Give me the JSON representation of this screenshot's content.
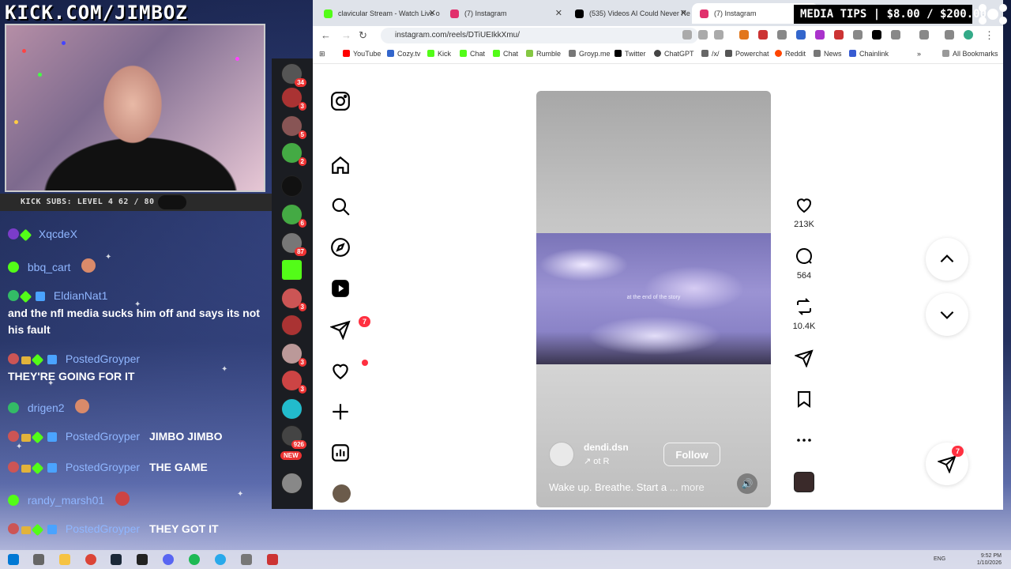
{
  "overlay": {
    "kick_header": "KICK.COM/JIMBOZ",
    "kick_subs": "KICK SUBS: LEVEL 4 62 / 80",
    "media_tips": "MEDIA TIPS | $8.00 / $200.00"
  },
  "chat": [
    {
      "user": "XqcdeX",
      "message": ""
    },
    {
      "user": "bbq_cart",
      "message": ""
    },
    {
      "user": "EldianNat1",
      "message": "and the nfl media sucks him off and says its not his fault"
    },
    {
      "user": "PostedGroyper",
      "message": "THEY'RE GOING FOR IT"
    },
    {
      "user": "drigen2",
      "message": ""
    },
    {
      "user": "PostedGroyper",
      "message": "JIMBO JIMBO"
    },
    {
      "user": "PostedGroyper",
      "message": "THE GAME"
    },
    {
      "user": "randy_marsh01",
      "message": ""
    },
    {
      "user": "PostedGroyper",
      "message": "THEY GOT IT"
    }
  ],
  "kick_sidebar": {
    "badges": [
      "34",
      "3",
      "5",
      "2",
      "6",
      "87",
      "3",
      "3",
      "3",
      "926"
    ],
    "new_label": "NEW"
  },
  "browser": {
    "tabs": [
      {
        "title": "clavicular Stream - Watch Live o",
        "color": "#53fc18"
      },
      {
        "title": "(7) Instagram",
        "color": "#e1306c"
      },
      {
        "title": "(535) Videos AI Could Never Re",
        "color": "#000000"
      },
      {
        "title": "(7) Instagram",
        "color": "#e1306c"
      }
    ],
    "url": "instagram.com/reels/DTiUEIkkXmu/",
    "bookmarks": [
      "YouTube",
      "Cozy.tv",
      "Kick",
      "Chat",
      "Chat",
      "Rumble",
      "Groyp.me",
      "Twitter",
      "ChatGPT",
      "/x/",
      "Powerchat",
      "Reddit",
      "News",
      "Chainlink"
    ],
    "all_bookmarks": "All Bookmarks"
  },
  "instagram": {
    "notification_count": "7",
    "reel": {
      "overlay_text": "at the end of the story",
      "username": "dendi.dsn",
      "audio": "↗ ot        R",
      "follow_label": "Follow",
      "caption": "Wake up. Breathe. Start a",
      "more_label": "... more"
    },
    "actions": {
      "likes": "213K",
      "comments": "564",
      "reposts": "10.4K"
    },
    "share_badge": "7"
  },
  "taskbar": {
    "lang": "ENG",
    "time": "9:52 PM",
    "date": "1/10/2026"
  }
}
